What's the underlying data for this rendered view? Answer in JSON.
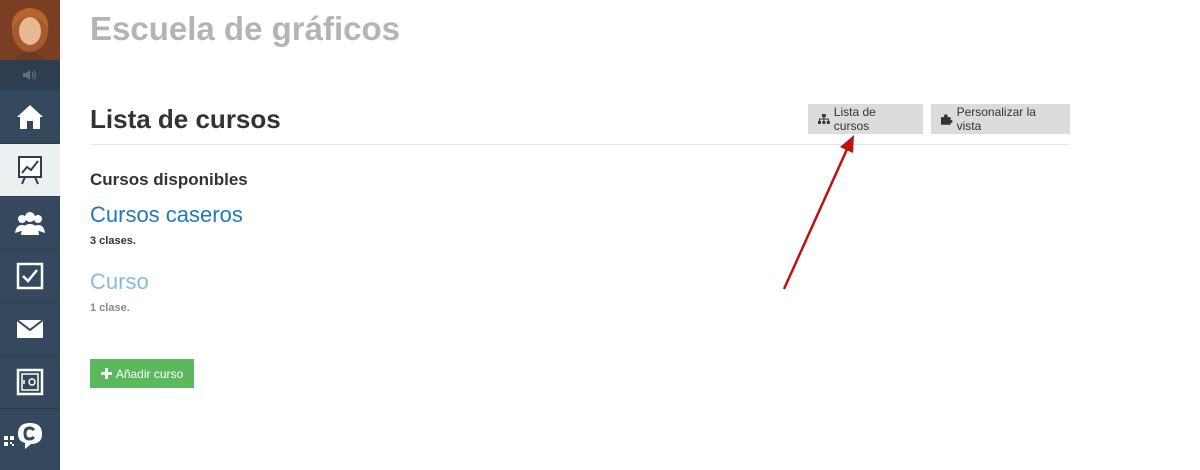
{
  "app": {
    "title": "Escuela de gráficos"
  },
  "sidebar": {
    "items": [
      {
        "icon": "home-icon"
      },
      {
        "icon": "chart-board-icon",
        "active": true
      },
      {
        "icon": "users-icon"
      },
      {
        "icon": "checkbox-icon"
      },
      {
        "icon": "mail-icon"
      },
      {
        "icon": "safe-icon"
      },
      {
        "icon": "chat-c-icon"
      }
    ]
  },
  "header": {
    "title": "Lista de cursos",
    "buttons": {
      "course_list": "Lista de cursos",
      "customize_view": "Personalizar la vista"
    }
  },
  "main": {
    "section_title": "Cursos disponibles",
    "courses": [
      {
        "name": "Cursos caseros",
        "meta": "3 clases."
      },
      {
        "name": "Curso",
        "meta": "1 clase."
      }
    ],
    "add_button": "Añadir curso"
  },
  "colors": {
    "sidebar": "#34495e",
    "link": "#1f7ab8",
    "link_muted": "#82bcd9",
    "green": "#5cb85c",
    "arrow": "#c01010"
  }
}
